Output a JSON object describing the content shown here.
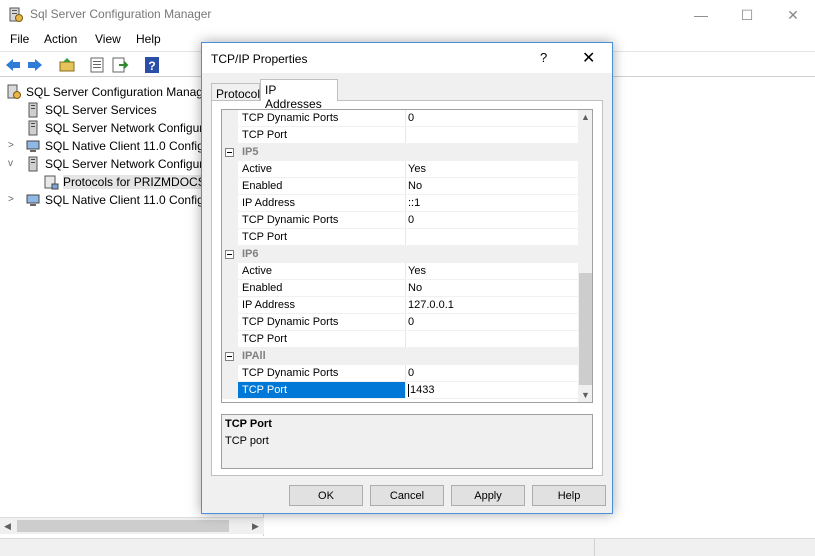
{
  "window": {
    "title": "Sql Server Configuration Manager",
    "minimize": "—",
    "maximize": "☐",
    "close": "✕"
  },
  "menu": [
    "File",
    "Action",
    "View",
    "Help"
  ],
  "tree": {
    "items": [
      {
        "label": "SQL Server Configuration Manager",
        "icon": "config-manager-icon"
      },
      {
        "label": "SQL Server Services",
        "icon": "server-services-icon"
      },
      {
        "label": "SQL Server Network Configura",
        "icon": "network-config-icon"
      },
      {
        "label": "SQL Native Client 11.0 Config",
        "icon": "native-client-icon"
      },
      {
        "label": "SQL Server Network Configura",
        "icon": "network-config-icon"
      },
      {
        "label": "Protocols for PRIZMDOCS",
        "icon": "protocols-icon"
      },
      {
        "label": "SQL Native Client 11.0 Config",
        "icon": "native-client-icon"
      }
    ]
  },
  "dialog": {
    "title": "TCP/IP Properties",
    "help": "?",
    "close": "✕",
    "tabs": [
      "Protocol",
      "IP Addresses"
    ],
    "active_tab": "IP Addresses",
    "rows": [
      {
        "type": "prop",
        "name": "TCP Dynamic Ports",
        "value": "0"
      },
      {
        "type": "prop",
        "name": "TCP Port",
        "value": ""
      },
      {
        "type": "cat",
        "name": "IP5"
      },
      {
        "type": "prop",
        "name": "Active",
        "value": "Yes"
      },
      {
        "type": "prop",
        "name": "Enabled",
        "value": "No"
      },
      {
        "type": "prop",
        "name": "IP Address",
        "value": "::1"
      },
      {
        "type": "prop",
        "name": "TCP Dynamic Ports",
        "value": "0"
      },
      {
        "type": "prop",
        "name": "TCP Port",
        "value": ""
      },
      {
        "type": "cat",
        "name": "IP6"
      },
      {
        "type": "prop",
        "name": "Active",
        "value": "Yes"
      },
      {
        "type": "prop",
        "name": "Enabled",
        "value": "No"
      },
      {
        "type": "prop",
        "name": "IP Address",
        "value": "127.0.0.1"
      },
      {
        "type": "prop",
        "name": "TCP Dynamic Ports",
        "value": "0"
      },
      {
        "type": "prop",
        "name": "TCP Port",
        "value": ""
      },
      {
        "type": "cat",
        "name": "IPAll"
      },
      {
        "type": "prop",
        "name": "TCP Dynamic Ports",
        "value": "0"
      },
      {
        "type": "prop",
        "name": "TCP Port",
        "value": "1433",
        "selected": true
      }
    ],
    "description": {
      "title": "TCP Port",
      "text": "TCP port"
    },
    "buttons": {
      "ok": "OK",
      "cancel": "Cancel",
      "apply": "Apply",
      "help": "Help"
    }
  },
  "colors": {
    "selection": "#0078d7",
    "dialog_border": "#4a90d9",
    "category_text": "#808080"
  }
}
